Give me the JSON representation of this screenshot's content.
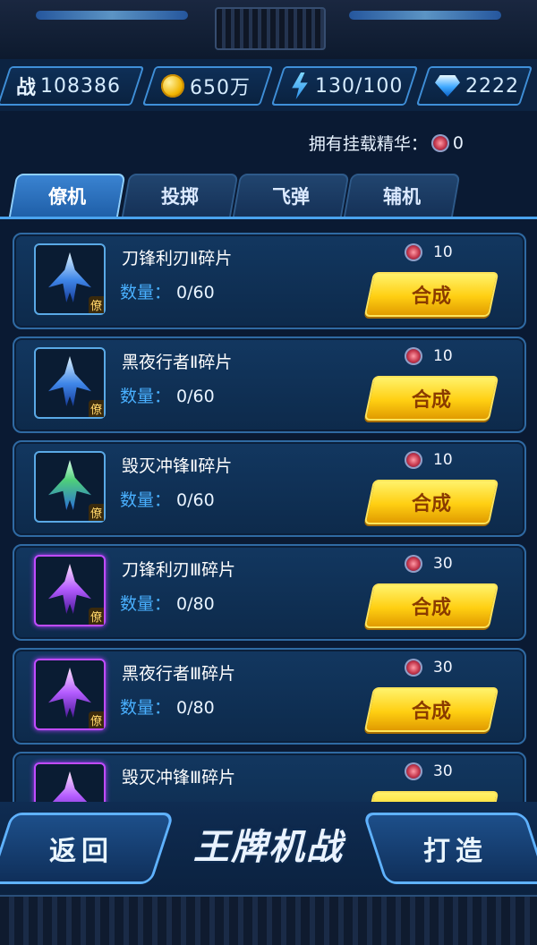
{
  "resources": {
    "combat_label": "战",
    "combat_value": "108386",
    "gold": "650万",
    "energy": "130/100",
    "diamonds": "2222"
  },
  "essence": {
    "label": "拥有挂载精华：",
    "count": "0"
  },
  "tabs": [
    "僚机",
    "投掷",
    "飞弹",
    "辅机"
  ],
  "active_tab": "僚机",
  "items": [
    {
      "name": "刀锋利刃Ⅱ碎片",
      "qty_label": "数量：",
      "qty": "0/60",
      "cost": "10",
      "button": "合成",
      "tag": "僚",
      "rarity": "blue",
      "ship_color": "blue"
    },
    {
      "name": "黑夜行者Ⅱ碎片",
      "qty_label": "数量：",
      "qty": "0/60",
      "cost": "10",
      "button": "合成",
      "tag": "僚",
      "rarity": "blue",
      "ship_color": "blue"
    },
    {
      "name": "毁灭冲锋Ⅱ碎片",
      "qty_label": "数量：",
      "qty": "0/60",
      "cost": "10",
      "button": "合成",
      "tag": "僚",
      "rarity": "blue",
      "ship_color": "green"
    },
    {
      "name": "刀锋利刃Ⅲ碎片",
      "qty_label": "数量：",
      "qty": "0/80",
      "cost": "30",
      "button": "合成",
      "tag": "僚",
      "rarity": "purple",
      "ship_color": "purple"
    },
    {
      "name": "黑夜行者Ⅲ碎片",
      "qty_label": "数量：",
      "qty": "0/80",
      "cost": "30",
      "button": "合成",
      "tag": "僚",
      "rarity": "purple",
      "ship_color": "purple"
    },
    {
      "name": "毁灭冲锋Ⅲ碎片",
      "qty_label": "数量：",
      "qty": "",
      "cost": "30",
      "button": "",
      "tag": "",
      "rarity": "purple",
      "ship_color": "purple"
    }
  ],
  "bottom": {
    "back": "返回",
    "logo": "王牌机战",
    "forge": "打造"
  },
  "icons": {
    "gold": "gold-coin-icon",
    "energy": "lightning-bolt-icon",
    "diamond": "diamond-gem-icon",
    "essence": "essence-crystal-icon"
  }
}
